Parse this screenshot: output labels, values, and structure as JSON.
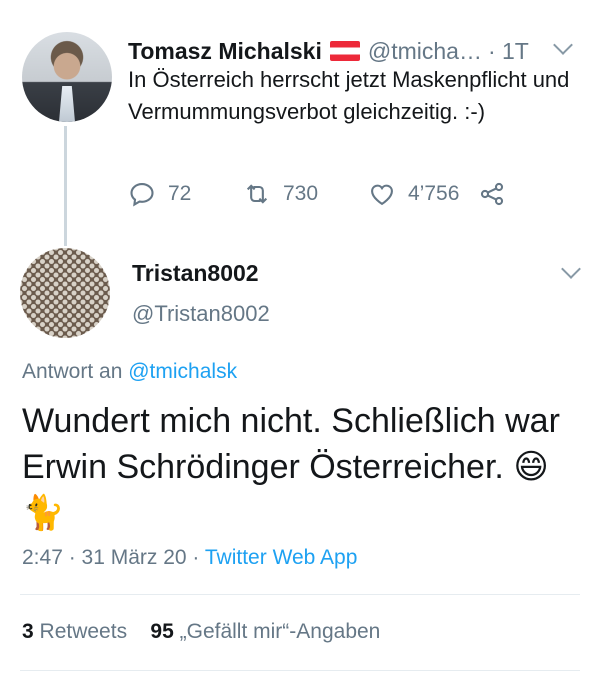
{
  "parent_tweet": {
    "author_name": "Tomasz Michalski",
    "handle": "@tmicha…",
    "time": "· 1T",
    "text": "In Österreich herrscht jetzt Maskenpflicht und Vermummungsverbot gleichzeitig. :-)",
    "replies": "72",
    "retweets": "730",
    "likes": "4’756",
    "icons": [
      "reply-icon",
      "retweet-icon",
      "like-icon",
      "share-icon"
    ]
  },
  "reply_tweet": {
    "author_name": "Tristan8002",
    "handle": "@Tristan8002",
    "reply_label": "Antwort an",
    "reply_to": "@tmichalsk",
    "text": "Wundert mich nicht. Schließlich war Erwin Schrödinger Österreicher.",
    "emojis": "😄🐈",
    "timestamp": "2:47 · 31 März 20 ·",
    "source_app": "Twitter Web App",
    "retweet_count": "3",
    "retweet_label": "Retweets",
    "like_count": "95",
    "like_label": "„Gefällt mir“-Angaben"
  },
  "colors": {
    "accent": "#1da1f2",
    "secondary_text": "#657786",
    "divider": "#e6ecf0"
  }
}
